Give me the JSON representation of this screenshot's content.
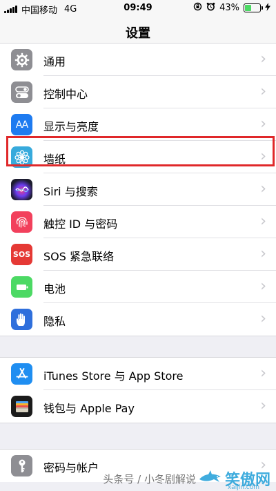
{
  "status_bar": {
    "carrier": "中国移动",
    "network": "4G",
    "time": "09:49",
    "battery_percent": "43%",
    "battery_level": 0.43,
    "icons": [
      "signal-icon",
      "orientation-lock-icon",
      "alarm-icon",
      "battery-icon",
      "charging-bolt-icon"
    ]
  },
  "nav": {
    "title": "设置"
  },
  "groups": [
    {
      "items": [
        {
          "label": "通用",
          "icon": "gear-icon",
          "color": "#8e8e93"
        },
        {
          "label": "控制中心",
          "icon": "toggles-icon",
          "color": "#8e8e93"
        },
        {
          "label": "显示与亮度",
          "icon": "text-size-icon",
          "color": "#1e7bf0",
          "icon_text": "AA"
        },
        {
          "label": "墙纸",
          "icon": "flower-icon",
          "color": "#37aadc",
          "highlighted": true
        },
        {
          "label": "Siri 与搜索",
          "icon": "siri-icon",
          "color": "#1c1c2e"
        },
        {
          "label": "触控 ID 与密码",
          "icon": "fingerprint-icon",
          "color": "#f2405c"
        },
        {
          "label": "SOS 紧急联络",
          "icon": "sos-icon",
          "color": "#e53935",
          "icon_text": "SOS"
        },
        {
          "label": "电池",
          "icon": "battery-icon",
          "color": "#4cd964"
        },
        {
          "label": "隐私",
          "icon": "hand-icon",
          "color": "#2f6fdc"
        }
      ]
    },
    {
      "items": [
        {
          "label": "iTunes Store 与 App Store",
          "icon": "app-store-icon",
          "color": "#1f8ef1"
        },
        {
          "label": "钱包与 Apple Pay",
          "icon": "wallet-icon",
          "color": "#1b1b1b"
        }
      ]
    },
    {
      "items": [
        {
          "label": "密码与帐户",
          "icon": "key-icon",
          "color": "#8e8e93"
        }
      ]
    }
  ],
  "watermark": {
    "text": "头条号 / 小冬剧解说",
    "site": "笑傲网",
    "url": "xaijin.com"
  }
}
